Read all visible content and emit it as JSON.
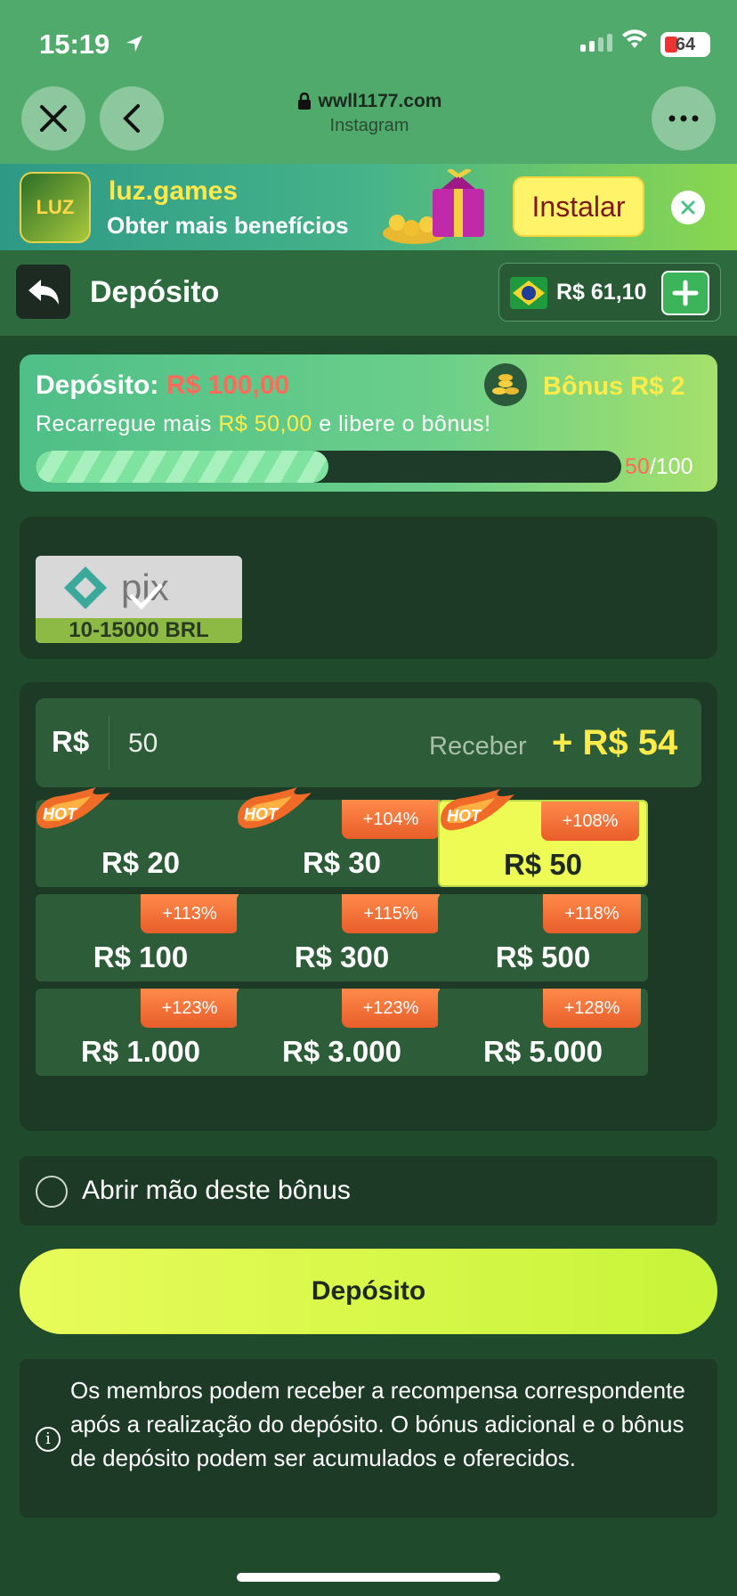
{
  "status_bar": {
    "time": "15:19",
    "battery": "64"
  },
  "browser": {
    "domain": "wwll1177.com",
    "source": "Instagram"
  },
  "promo": {
    "brand": "luz.games",
    "subtitle": "Obter mais benefícios",
    "logo_text": "LUZ",
    "install_label": "Instalar"
  },
  "header": {
    "title": "Depósito",
    "balance": "R$ 61,10"
  },
  "bonus": {
    "label": "Depósito:",
    "amount": "R$ 100,00",
    "bonus_text": "Bônus R$ 2",
    "recharge_prefix": "Recarregue mais",
    "recharge_amount": "R$ 50,00",
    "recharge_suffix": "e libere o bônus!",
    "progress_current": "50",
    "progress_total": "/100",
    "progress_fraction": 0.5
  },
  "payment": {
    "method_range": "10-15000 BRL",
    "method_name": "pix"
  },
  "amount_input": {
    "currency": "R$",
    "value": "50",
    "receive_label": "Receber",
    "receive_value": "+ R$ 54"
  },
  "amounts": [
    {
      "label": "R$ 20",
      "badge": "",
      "hot": true,
      "selected": false
    },
    {
      "label": "R$ 30",
      "badge": "+104%",
      "hot": true,
      "selected": false
    },
    {
      "label": "R$ 50",
      "badge": "+108%",
      "hot": true,
      "selected": true
    },
    {
      "label": "R$ 100",
      "badge": "+113%",
      "hot": false,
      "selected": false
    },
    {
      "label": "R$ 300",
      "badge": "+115%",
      "hot": false,
      "selected": false
    },
    {
      "label": "R$ 500",
      "badge": "+118%",
      "hot": false,
      "selected": false
    },
    {
      "label": "R$ 1.000",
      "badge": "+123%",
      "hot": false,
      "selected": false
    },
    {
      "label": "R$ 3.000",
      "badge": "+123%",
      "hot": false,
      "selected": false
    },
    {
      "label": "R$ 5.000",
      "badge": "+128%",
      "hot": false,
      "selected": false
    }
  ],
  "hot_label": "HOT",
  "forfeit": {
    "label": "Abrir mão deste bônus"
  },
  "deposit_button": "Depósito",
  "info": {
    "text": "Os membros podem receber a recompensa correspondente após a realização do depósito. O bónus adicional e o bônus de depósito podem ser acumulados e oferecidos."
  },
  "colors": {
    "accent_yellow": "#ffec4a",
    "accent_red": "#ff6b5a",
    "panel": "#1d3a26",
    "button": "#e8fb5a"
  }
}
